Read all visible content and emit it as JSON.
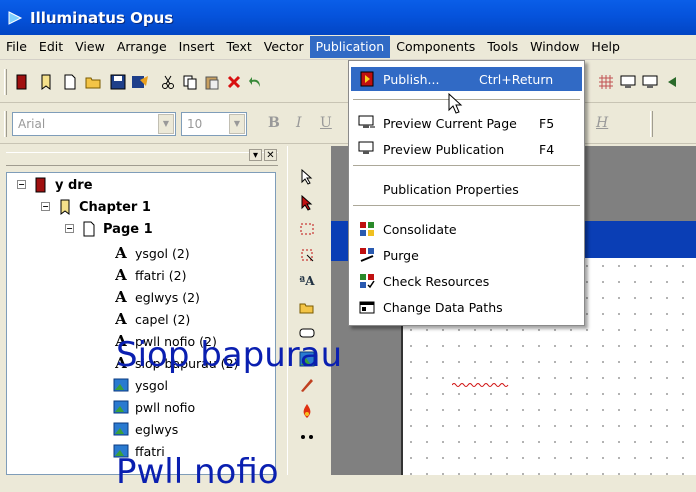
{
  "app": {
    "title": "Illuminatus Opus"
  },
  "menubar": {
    "items": [
      "File",
      "Edit",
      "View",
      "Arrange",
      "Insert",
      "Text",
      "Vector",
      "Publication",
      "Components",
      "Tools",
      "Window",
      "Help"
    ],
    "active": "Publication"
  },
  "toolbar2": {
    "font_name": "Arial",
    "font_size": "10",
    "bold_label": "B",
    "italic_label": "I",
    "underline_label": "U"
  },
  "tree": {
    "root": "y dre",
    "chapter": "Chapter 1",
    "page": "Page 1",
    "items": [
      {
        "label": "ysgol (2)",
        "icon": "text-object-icon"
      },
      {
        "label": "ffatri (2)",
        "icon": "text-object-icon"
      },
      {
        "label": "eglwys (2)",
        "icon": "text-object-icon"
      },
      {
        "label": "capel (2)",
        "icon": "text-object-icon"
      },
      {
        "label": "pwll nofio (2)",
        "icon": "text-object-icon"
      },
      {
        "label": "siop bapurau (2)",
        "icon": "text-object-icon"
      },
      {
        "label": "ysgol",
        "icon": "picture-object-icon"
      },
      {
        "label": "pwll nofio",
        "icon": "picture-object-icon"
      },
      {
        "label": "eglwys",
        "icon": "picture-object-icon"
      },
      {
        "label": "ffatri",
        "icon": "picture-object-icon"
      }
    ]
  },
  "canvas": {
    "text1": "Siop bapurau",
    "text2": "Pwll nofio"
  },
  "dropdown": {
    "items": [
      {
        "label": "Publish...",
        "shortcut": "Ctrl+Return",
        "icon": "publish-icon",
        "highlighted": true
      },
      {
        "label": "Preview Current Page",
        "shortcut": "F5",
        "icon": "preview-page-icon"
      },
      {
        "label": "Preview Publication",
        "shortcut": "F4",
        "icon": "preview-publication-icon"
      },
      {
        "label": "Publication Properties",
        "shortcut": "",
        "icon": ""
      },
      {
        "label": "Consolidate",
        "shortcut": "",
        "icon": "consolidate-icon"
      },
      {
        "label": "Purge",
        "shortcut": "",
        "icon": "purge-icon"
      },
      {
        "label": "Check Resources",
        "shortcut": "",
        "icon": "check-resources-icon"
      },
      {
        "label": "Change Data Paths",
        "shortcut": "",
        "icon": "change-data-paths-icon"
      }
    ]
  },
  "colors": {
    "titlebar": "#0553dc",
    "highlight": "#316ac5",
    "canvas_text": "#0a1fb0"
  }
}
